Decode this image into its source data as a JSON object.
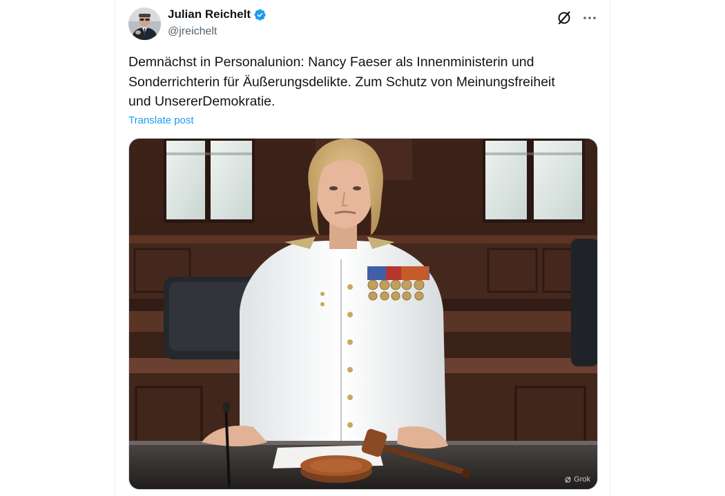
{
  "author": {
    "display_name": "Julian Reichelt",
    "handle": "@jreichelt",
    "verified_color": "#1d9bf0"
  },
  "post": {
    "text": "Demnächst in Personalunion: Nancy Faeser als Innenministerin und\nSonderrichterin für Äußerungsdelikte. Zum Schutz von Meinungsfreiheit\nund UnsererDemokratie.",
    "translate_label": "Translate post"
  },
  "media": {
    "watermark": "Grok"
  },
  "actions": {
    "grok_icon": "grok-slash-icon",
    "more_icon": "more-dots-icon"
  }
}
